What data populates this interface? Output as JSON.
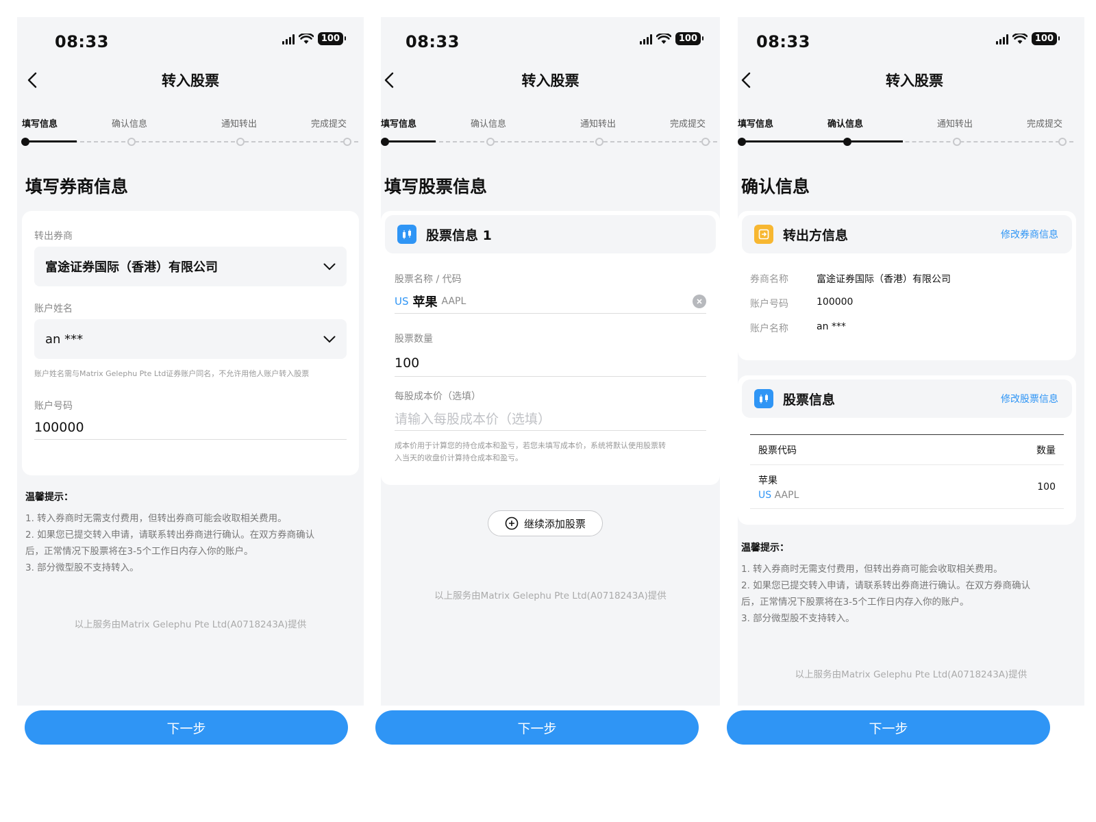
{
  "status": {
    "time": "08:33",
    "battery": "100"
  },
  "nav": {
    "title": "转入股票"
  },
  "steps": [
    "填写信息",
    "确认信息",
    "通知转出",
    "完成提交"
  ],
  "screen1": {
    "section_title": "填写券商信息",
    "broker_label": "转出券商",
    "broker_value": "富途证券国际（香港）有限公司",
    "name_label": "账户姓名",
    "name_value": "an ***",
    "name_hint": "账户姓名需与Matrix Gelephu Pte Ltd证券账户同名，不允许用他人账户转入股票",
    "account_label": "账户号码",
    "account_value": "100000"
  },
  "tips": {
    "title": "温馨提示：",
    "items": [
      "1. 转入券商时无需支付费用，但转出券商可能会收取相关费用。",
      "2. 如果您已提交转入申请，请联系转出券商进行确认。在双方券商确认",
      "后，正常情况下股票将在3-5个工作日内存入你的账户。",
      "3. 部分微型股不支持转入。"
    ]
  },
  "provider": "以上服务由Matrix Gelephu Pte Ltd(A0718243A)提供",
  "next_label": "下一步",
  "screen2": {
    "section_title": "填写股票信息",
    "card_title": "股票信息 1",
    "stock_label": "股票名称 / 代码",
    "stock_market": "US",
    "stock_name": "苹果",
    "stock_code": "AAPL",
    "qty_label": "股票数量",
    "qty_value": "100",
    "cost_label": "每股成本价（选填）",
    "cost_placeholder": "请输入每股成本价（选填）",
    "cost_hint_1": "成本价用于计算您的持仓成本和盈亏，若您未填写成本价，系统将默认使用股票转",
    "cost_hint_2": "入当天的收盘价计算持仓成本和盈亏。",
    "add_label": "继续添加股票"
  },
  "screen3": {
    "section_title": "确认信息",
    "transfer_title": "转出方信息",
    "edit_broker": "修改券商信息",
    "rows": [
      {
        "k": "券商名称",
        "v": "富途证券国际（香港）有限公司"
      },
      {
        "k": "账户号码",
        "v": "100000"
      },
      {
        "k": "账户名称",
        "v": "an ***"
      }
    ],
    "stock_title": "股票信息",
    "edit_stock": "修改股票信息",
    "col_code": "股票代码",
    "col_qty": "数量",
    "row_name": "苹果",
    "row_market": "US",
    "row_code": "AAPL",
    "row_qty": "100"
  },
  "colors": {
    "accent": "#2f95f5",
    "background": "#f4f5f7",
    "icon_yellow": "#f7b731"
  }
}
